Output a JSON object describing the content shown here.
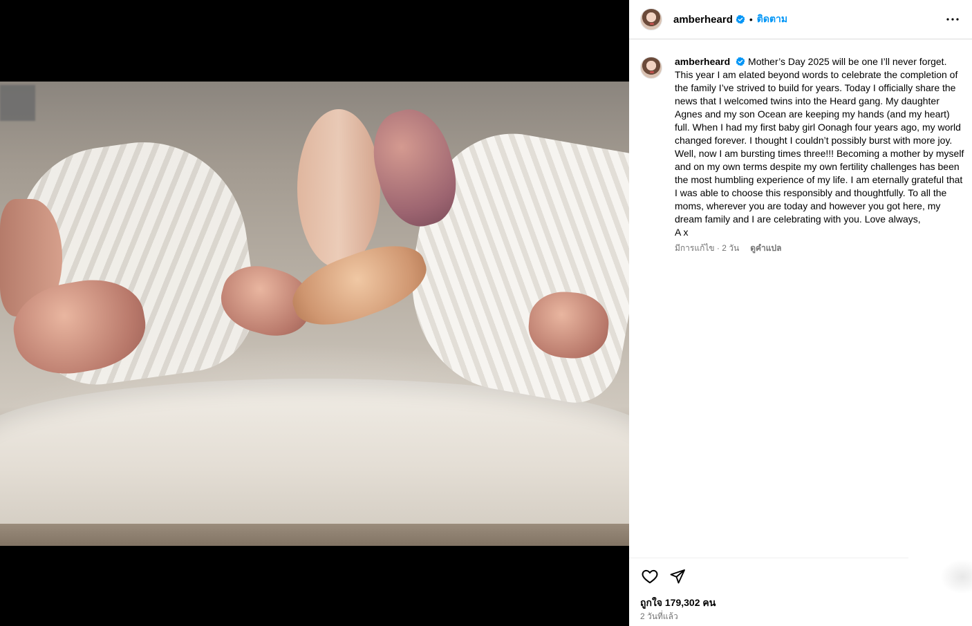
{
  "post": {
    "username": "amberheard",
    "follow_label": "ติดตาม",
    "separator": "•",
    "caption_user": "amberheard",
    "caption_text": "Mother’s Day 2025 will be one I’ll never forget. This year I am elated beyond words to celebrate the completion of the family I’ve strived to build for years. Today I officially share the news that I welcomed twins into the Heard gang. My daughter Agnes and my son Ocean are keeping my hands (and my heart) full. When I had my first baby girl Oonagh four years ago, my world changed forever. I thought I couldn’t possibly burst with more joy. Well, now I am bursting times three!!! Becoming a mother by myself and on my own terms despite my own fertility challenges has been the most humbling experience of my life. I am eternally grateful that I was able to choose this responsibly and thoughtfully. To all the moms, wherever you are today and however you got here, my dream family and I are celebrating with you. Love always,\nA x",
    "edited_meta": "มีการแก้ไข · 2 วัน",
    "translate_label": "ดูคำแปล",
    "likes_text": "ถูกใจ 179,302 คน",
    "posted_time": "2 วันที่แล้ว"
  },
  "icons": {
    "verified": "verified-badge-icon",
    "more": "more-options-icon",
    "like": "heart-icon",
    "share": "send-icon"
  },
  "colors": {
    "accent": "#0095f6",
    "muted": "#737373",
    "border": "#dbdbdb"
  }
}
